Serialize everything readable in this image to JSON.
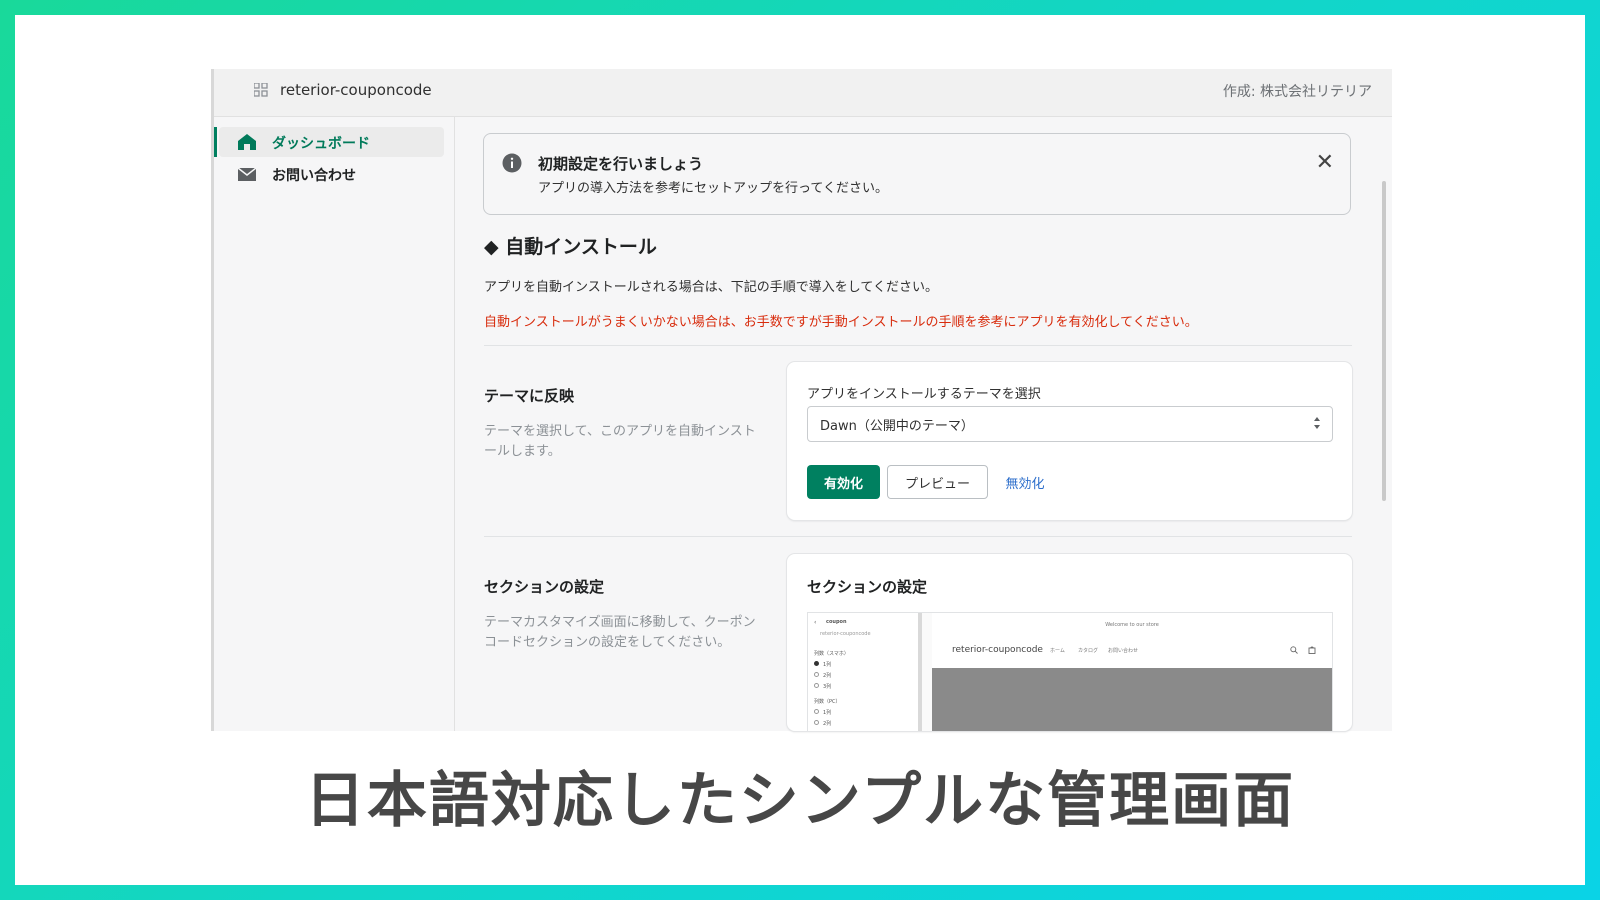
{
  "header": {
    "app_name": "reterior-couponcode",
    "author": "作成: 株式会社リテリア"
  },
  "sidebar": {
    "items": [
      {
        "label": "ダッシュボード",
        "icon": "home-icon",
        "active": true
      },
      {
        "label": "お問い合わせ",
        "icon": "mail-icon",
        "active": false
      }
    ]
  },
  "banner": {
    "icon": "info-icon",
    "title": "初期設定を行いましょう",
    "text": "アプリの導入方法を参考にセットアップを行ってください。",
    "close": "✕"
  },
  "auto_install": {
    "heading": "◆ 自動インストール",
    "description": "アプリを自動インストールされる場合は、下記の手順で導入をしてください。",
    "warning": "自動インストールがうまくいかない場合は、お手数ですが手動インストールの手順を参考にアプリを有効化してください。"
  },
  "theme_section": {
    "title": "テーマに反映",
    "description": "テーマを選択して、このアプリを自動インストールします。",
    "select_label": "アプリをインストールするテーマを選択",
    "select_value": "Dawn（公開中のテーマ）",
    "enable_button": "有効化",
    "preview_button": "プレビュー",
    "disable_link": "無効化"
  },
  "section_settings": {
    "title": "セクションの設定",
    "description": "テーマカスタマイズ画面に移動して、クーポンコードセクションの設定をしてください。",
    "card_title": "セクションの設定",
    "preview": {
      "back": "‹",
      "panel_title": "coupon",
      "panel_sub": "reterior-couponcode",
      "group1": "列数（スマホ）",
      "group1_options": [
        "1列",
        "2列",
        "3列"
      ],
      "group2": "列数（PC）",
      "group2_options": [
        "1列",
        "2列"
      ],
      "welcome": "Welcome to our store",
      "store_name": "reterior-couponcode",
      "nav_items": [
        "ホーム",
        "カタログ",
        "お問い合わせ"
      ]
    }
  },
  "caption": "日本語対応したシンプルな管理画面",
  "colors": {
    "accent": "#008060",
    "warning": "#d82c0d",
    "link": "#2c6ecb"
  }
}
